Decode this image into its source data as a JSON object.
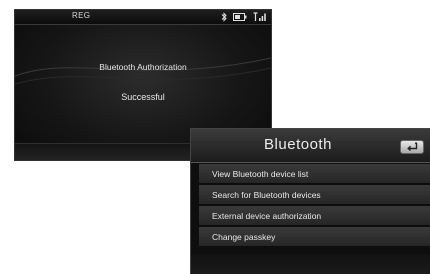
{
  "auth_screen": {
    "status_bar": {
      "region_label": "REG",
      "icons": [
        "bluetooth-icon",
        "battery-icon",
        "signal-icon"
      ]
    },
    "message_title": "Bluetooth Authorization",
    "message_result": "Successful"
  },
  "bluetooth_menu": {
    "title": "Bluetooth",
    "back_icon": "back-arrow-icon",
    "items": [
      {
        "label": "View Bluetooth device list"
      },
      {
        "label": "Search for Bluetooth devices"
      },
      {
        "label": "External device authorization"
      },
      {
        "label": "Change passkey"
      }
    ]
  },
  "colors": {
    "screen_background": "#0e0e0e",
    "text": "#e8e8e8",
    "menu_item": "#333333",
    "back_button": "#cfcfcf"
  }
}
